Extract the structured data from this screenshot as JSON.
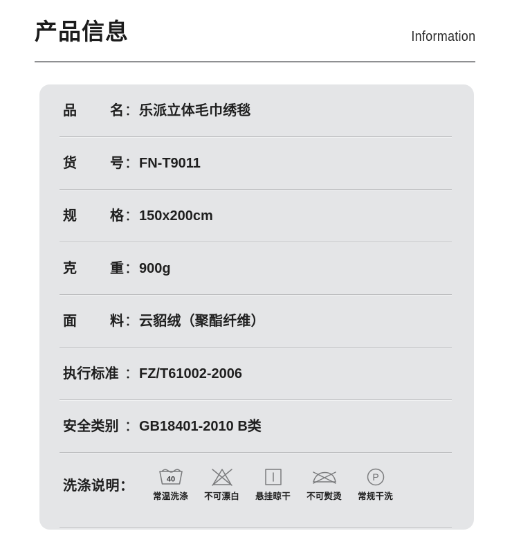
{
  "header": {
    "title": "产品信息",
    "subtitle": "Information",
    "rule_color": "#8f9092"
  },
  "card": {
    "background_color": "#e4e5e7",
    "divider_color": "#b9babc",
    "text_color": "#1f1f1f"
  },
  "specs": [
    {
      "label": "品　名",
      "label_style": "sparse",
      "colon": "：",
      "value": "乐派立体毛巾绣毯",
      "value_type": "cjk"
    },
    {
      "label": "货　号",
      "label_style": "sparse",
      "colon": "：",
      "value": "FN-T9011",
      "value_type": "latin"
    },
    {
      "label": "规　格",
      "label_style": "sparse",
      "colon": "：",
      "value": "150x200cm",
      "value_type": "latin"
    },
    {
      "label": "克　重",
      "label_style": "sparse",
      "colon": "：",
      "value": "900g",
      "value_type": "latin"
    },
    {
      "label": "面　料",
      "label_style": "sparse",
      "colon": "：",
      "value": "云貂绒（聚酯纤维）",
      "value_type": "cjk"
    },
    {
      "label": "执行标准",
      "label_style": "dense",
      "colon": "：",
      "value": "FZ/T61002-2006",
      "value_type": "latin"
    },
    {
      "label": "安全类别",
      "label_style": "dense",
      "colon": "：",
      "value": "GB18401-2010 B类",
      "value_type": "latin"
    }
  ],
  "care": {
    "label": "洗涤说明：",
    "symbols": [
      {
        "icon": "wash-tub-40-icon",
        "temperature": "40",
        "caption": "常温洗涤"
      },
      {
        "icon": "do-not-bleach-icon",
        "caption": "不可漂白"
      },
      {
        "icon": "line-dry-icon",
        "caption": "悬挂晾干"
      },
      {
        "icon": "do-not-iron-icon",
        "caption": "不可熨烫"
      },
      {
        "icon": "dryclean-p-icon",
        "caption": "常规干洗"
      }
    ],
    "symbol_color": "#7b7c7e"
  }
}
